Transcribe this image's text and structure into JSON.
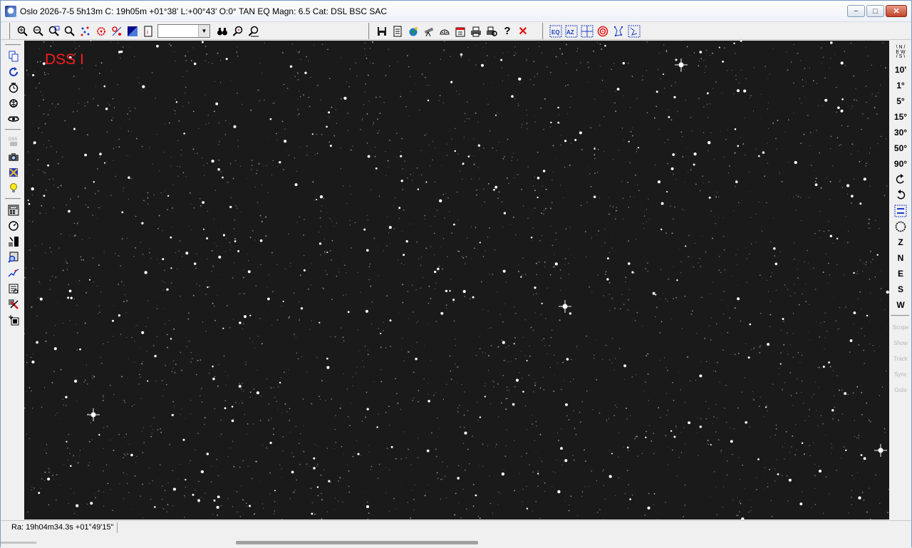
{
  "window": {
    "title": "Oslo 2026-7-5   5h13m C: 19h05m +01°38' L:+00°43' O:0° TAN EQ Magn: 6.5 Cat: DSL BSC SAC",
    "minimize": "−",
    "maximize": "□",
    "close": "✕"
  },
  "toolbar": {
    "zoom_value": "",
    "help_label": "?",
    "close_label": "✕"
  },
  "sky": {
    "label": "DSS I",
    "background": "#1a1a1a",
    "label_color": "#ff1a1a"
  },
  "right_toolbar": {
    "compass_top": "\\ N /",
    "compass_mid": "E W",
    "compass_bot": "/ S \\",
    "fov": [
      "10'",
      "1°",
      "5°",
      "15°",
      "30°",
      "50°",
      "90°"
    ],
    "directions": [
      "Z",
      "N",
      "E",
      "S",
      "W"
    ],
    "scope": [
      "Scope",
      "Show",
      "Track",
      "Sync",
      "Goto"
    ]
  },
  "statusbar": {
    "coords": "Ra: 19h04m34.3s +01°49'15\""
  }
}
